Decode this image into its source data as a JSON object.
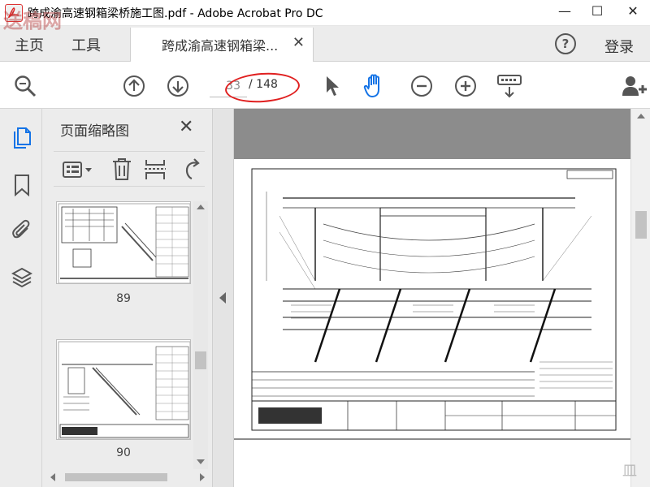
{
  "window": {
    "title": "跨成渝高速钢箱梁桥施工图.pdf - Adobe Acrobat Pro DC",
    "minimize": "—",
    "maximize": "☐",
    "close": "✕"
  },
  "menubar": {
    "home": "主页",
    "tools": "工具",
    "tab_label": "跨成渝高速钢箱梁...",
    "tab_close": "✕",
    "help": "?",
    "login": "登录"
  },
  "toolbar": {
    "current_page": "33",
    "total_pages": "/ 148",
    "icons": [
      "search-zoom-icon",
      "arrow-up-icon",
      "arrow-down-icon",
      "select-cursor-icon",
      "hand-tool-icon",
      "zoom-out-icon",
      "zoom-in-icon",
      "keyboard-scroll-icon",
      "add-user-icon"
    ]
  },
  "left_rail": {
    "icons": [
      "page-thumbnails-icon",
      "bookmark-icon",
      "attachment-icon",
      "layers-icon"
    ]
  },
  "thumbnail_panel": {
    "title": "页面缩略图",
    "close": "✕",
    "tools": [
      "thumbnail-options-icon",
      "delete-page-icon",
      "insert-page-icon",
      "rotate-page-icon"
    ],
    "thumbnails": [
      {
        "number": "89"
      },
      {
        "number": "90"
      }
    ]
  },
  "watermark": {
    "left": "送稿网",
    "right": "皿"
  },
  "colors": {
    "annotation_red": "#e02020",
    "accent_blue": "#1473e6"
  }
}
